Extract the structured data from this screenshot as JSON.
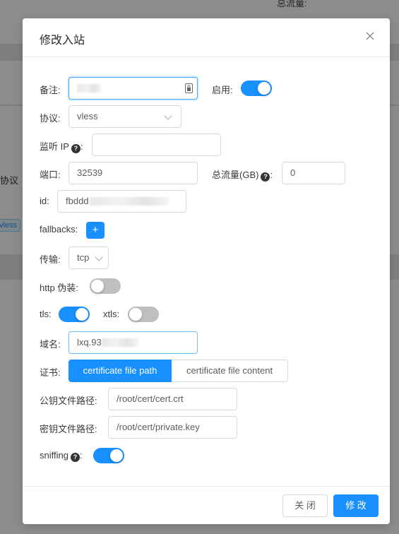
{
  "background": {
    "traffic_label": "总流量:",
    "traffic_badge": "",
    "column_protocol": "协议",
    "tag_vless": "vless"
  },
  "modal": {
    "title": "修改入站",
    "remark": {
      "label": "备注:",
      "value": ""
    },
    "enable": {
      "label": "启用:",
      "on": true
    },
    "protocol": {
      "label": "协议:",
      "value": "vless"
    },
    "listen_ip": {
      "label": "监听 IP",
      "help": "?",
      "colon": ":",
      "value": ""
    },
    "port": {
      "label": "端口:",
      "value": "32539"
    },
    "total_traffic": {
      "label": "总流量(GB)",
      "help": "?",
      "colon": ":",
      "value": "0"
    },
    "id": {
      "label": "id:",
      "value": "fbddd"
    },
    "fallbacks": {
      "label": "fallbacks:",
      "add": "+"
    },
    "transport": {
      "label": "传输:",
      "value": "tcp"
    },
    "http_obfs": {
      "label": "http 伪装:",
      "on": false
    },
    "tls": {
      "label": "tls:",
      "on": true
    },
    "xtls": {
      "label": "xtls:",
      "on": false
    },
    "domain": {
      "label": "域名:",
      "value": "lxq.93"
    },
    "cert": {
      "label": "证书:",
      "tabs": [
        "certificate file path",
        "certificate file content"
      ],
      "active": 0
    },
    "public_key_path": {
      "label": "公钥文件路径:",
      "value": "/root/cert/cert.crt"
    },
    "private_key_path": {
      "label": "密钥文件路径:",
      "value": "/root/cert/private.key"
    },
    "sniffing": {
      "label": "sniffing",
      "help": "?",
      "colon": ":",
      "on": true
    },
    "footer": {
      "close": "关 闭",
      "submit": "修 改"
    }
  },
  "colors": {
    "primary": "#1890ff",
    "switch_off": "#bfbfbf",
    "mask": "rgba(0,0,0,0.45)"
  },
  "icons": {
    "close": "close-icon",
    "help": "question-circle-icon",
    "lock": "password-manager-icon"
  }
}
